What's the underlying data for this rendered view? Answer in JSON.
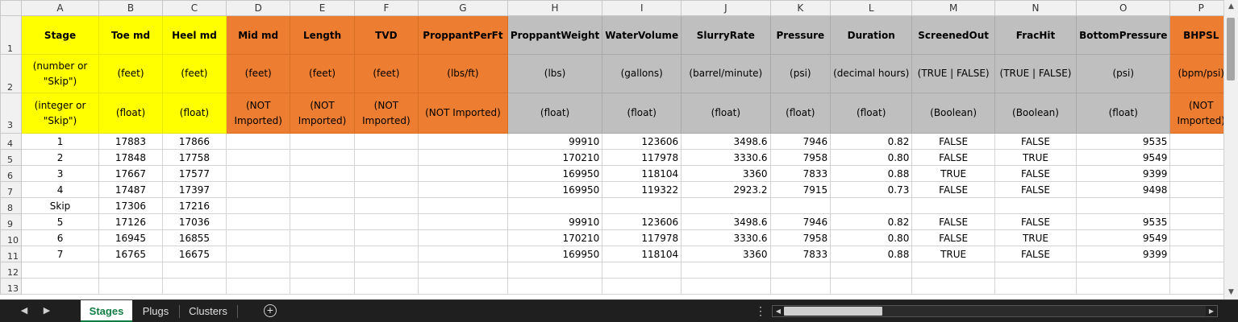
{
  "columns": [
    "A",
    "B",
    "C",
    "D",
    "E",
    "F",
    "G",
    "H",
    "I",
    "J",
    "K",
    "L",
    "M",
    "N",
    "O",
    "P"
  ],
  "header_names": [
    "Stage",
    "Toe md",
    "Heel md",
    "Mid md",
    "Length",
    "TVD",
    "ProppantPerFt",
    "ProppantWeight",
    "WaterVolume",
    "SlurryRate",
    "Pressure",
    "Duration",
    "ScreenedOut",
    "FracHit",
    "BottomPressure",
    "BHPSL"
  ],
  "header_units": [
    "(number or \"Skip\")",
    "(feet)",
    "(feet)",
    "(feet)",
    "(feet)",
    "(feet)",
    "(lbs/ft)",
    "(lbs)",
    "(gallons)",
    "(barrel/minute)",
    "(psi)",
    "(decimal hours)",
    "(TRUE | FALSE)",
    "(TRUE | FALSE)",
    "(psi)",
    "(bpm/psi)"
  ],
  "header_types": [
    "(integer or \"Skip\")",
    "(float)",
    "(float)",
    "(NOT Imported)",
    "(NOT Imported)",
    "(NOT Imported)",
    "(NOT Imported)",
    "(float)",
    "(float)",
    "(float)",
    "(float)",
    "(float)",
    "(Boolean)",
    "(Boolean)",
    "(float)",
    "(NOT Imported)"
  ],
  "rows": [
    [
      "1",
      "17883",
      "17866",
      "",
      "",
      "",
      "",
      "99910",
      "123606",
      "3498.6",
      "7946",
      "0.82",
      "FALSE",
      "FALSE",
      "9535",
      ""
    ],
    [
      "2",
      "17848",
      "17758",
      "",
      "",
      "",
      "",
      "170210",
      "117978",
      "3330.6",
      "7958",
      "0.80",
      "FALSE",
      "TRUE",
      "9549",
      ""
    ],
    [
      "3",
      "17667",
      "17577",
      "",
      "",
      "",
      "",
      "169950",
      "118104",
      "3360",
      "7833",
      "0.88",
      "TRUE",
      "FALSE",
      "9399",
      ""
    ],
    [
      "4",
      "17487",
      "17397",
      "",
      "",
      "",
      "",
      "169950",
      "119322",
      "2923.2",
      "7915",
      "0.73",
      "FALSE",
      "FALSE",
      "9498",
      ""
    ],
    [
      "Skip",
      "17306",
      "17216",
      "",
      "",
      "",
      "",
      "",
      "",
      "",
      "",
      "",
      "",
      "",
      "",
      ""
    ],
    [
      "5",
      "17126",
      "17036",
      "",
      "",
      "",
      "",
      "99910",
      "123606",
      "3498.6",
      "7946",
      "0.82",
      "FALSE",
      "FALSE",
      "9535",
      ""
    ],
    [
      "6",
      "16945",
      "16855",
      "",
      "",
      "",
      "",
      "170210",
      "117978",
      "3330.6",
      "7958",
      "0.80",
      "FALSE",
      "TRUE",
      "9549",
      ""
    ],
    [
      "7",
      "16765",
      "16675",
      "",
      "",
      "",
      "",
      "169950",
      "118104",
      "3360",
      "7833",
      "0.88",
      "TRUE",
      "FALSE",
      "9399",
      ""
    ],
    [
      "",
      "",
      "",
      "",
      "",
      "",
      "",
      "",
      "",
      "",
      "",
      "",
      "",
      "",
      "",
      ""
    ],
    [
      "",
      "",
      "",
      "",
      "",
      "",
      "",
      "",
      "",
      "",
      "",
      "",
      "",
      "",
      "",
      ""
    ]
  ],
  "row_numbers": [
    "1",
    "2",
    "3",
    "4",
    "5",
    "6",
    "7",
    "8",
    "9",
    "10",
    "11",
    "12",
    "13"
  ],
  "sheet_tabs": {
    "stages": "Stages",
    "plugs": "Plugs",
    "clusters": "Clusters"
  },
  "colors": {
    "yellow": "#ffff00",
    "orange": "#ed7d31",
    "gray": "#bfbfbf",
    "accent": "#107c41"
  }
}
